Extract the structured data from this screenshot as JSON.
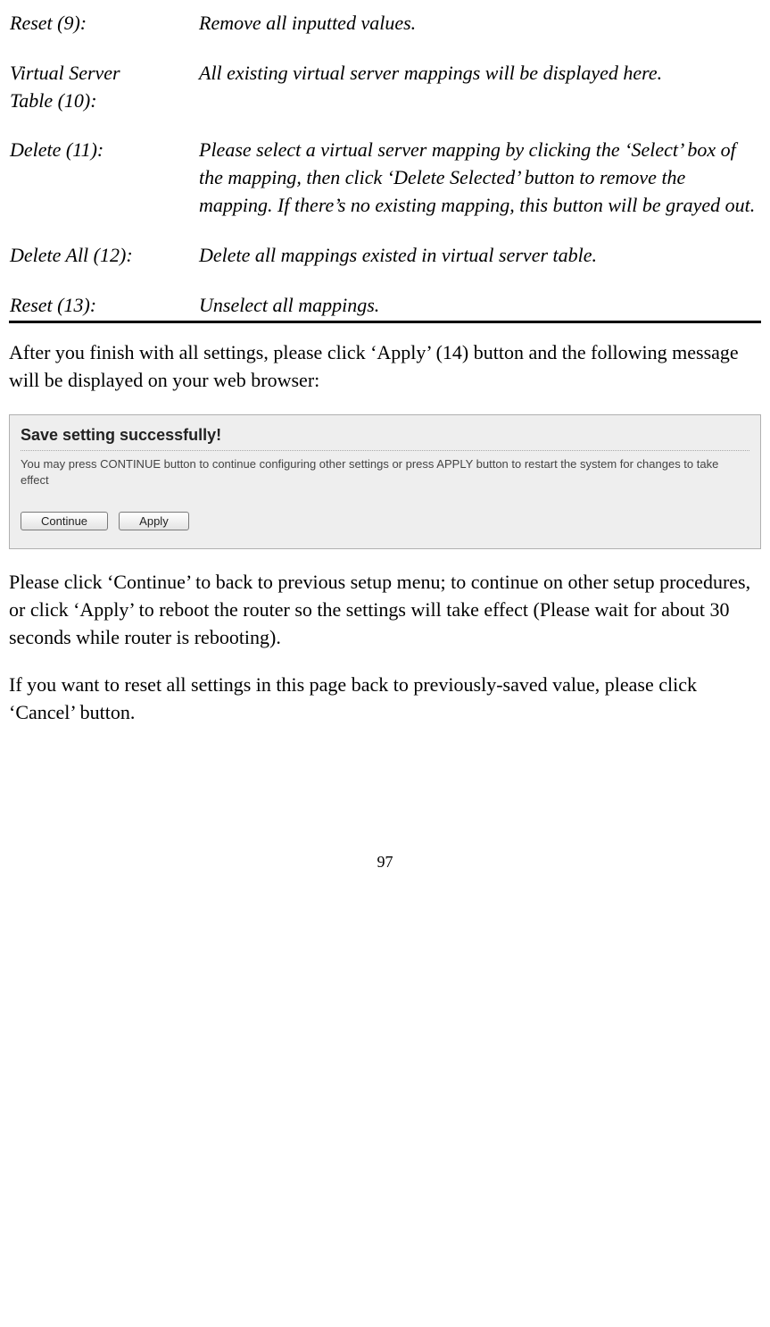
{
  "defs": [
    {
      "term": "Reset (9):",
      "desc": "Remove all inputted values."
    },
    {
      "term": "Virtual Server Table (10):",
      "desc": "All existing virtual server mappings will be displayed here."
    },
    {
      "term": "Delete (11):",
      "desc": "Please select a virtual server mapping by clicking the ‘Select’ box of the mapping, then click ‘Delete Selected’ button to remove the mapping. If there’s no existing mapping, this button will be grayed out."
    },
    {
      "term": "Delete All (12):",
      "desc": "Delete all mappings existed in virtual server table."
    },
    {
      "term": "Reset (13):",
      "desc": "Unselect all mappings."
    }
  ],
  "para1": "After you finish with all settings, please click ‘Apply’ (14) button and the following message will be displayed on your web browser:",
  "panel": {
    "title": "Save setting successfully!",
    "body": "You may press CONTINUE button to continue configuring other settings or press APPLY button to restart the system for changes to take effect",
    "continue_label": "Continue",
    "apply_label": "Apply"
  },
  "para2": "Please click ‘Continue’ to back to previous setup menu; to continue on other setup procedures, or click ‘Apply’ to reboot the router so the settings will take effect (Please wait for about 30 seconds while router is rebooting).",
  "para3": "If you want to reset all settings in this page back to previously-saved value, please click ‘Cancel’ button.",
  "page_number": "97"
}
